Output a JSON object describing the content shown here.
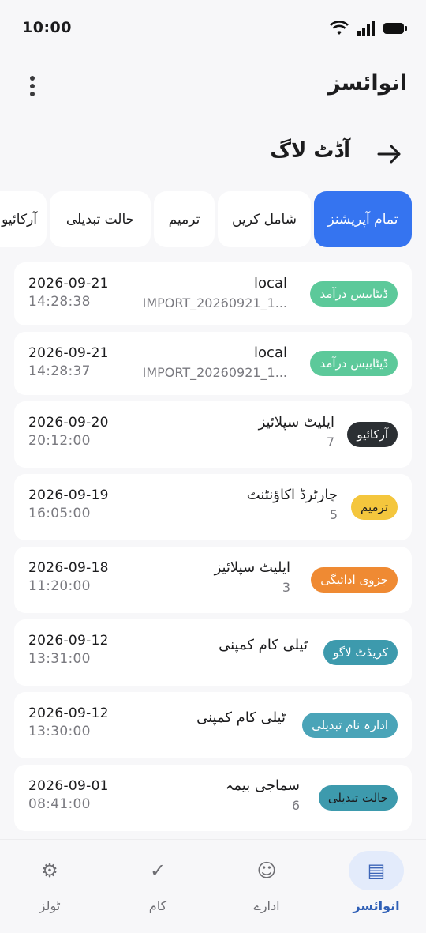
{
  "status_bar": {
    "time": "10:00"
  },
  "app_bar": {
    "title": "انوائسز"
  },
  "section": {
    "title": "آڈٹ لاگ"
  },
  "filters": [
    {
      "label": "تمام آپریشنز",
      "active": true
    },
    {
      "label": "شامل کریں",
      "active": false
    },
    {
      "label": "ترمیم",
      "active": false
    },
    {
      "label": "حالت تبدیلی",
      "active": false
    },
    {
      "label": "آرکائیو",
      "active": false
    }
  ],
  "entries": [
    {
      "badge": "ڈیٹابیس درآمد",
      "badge_color": "#5cc99a",
      "badge_text_color": "#ffffff",
      "title": "local",
      "subtitle": "IMPORT_20260921_1...",
      "date": "2026-09-21",
      "time": "14:28:38"
    },
    {
      "badge": "ڈیٹابیس درآمد",
      "badge_color": "#5cc99a",
      "badge_text_color": "#ffffff",
      "title": "local",
      "subtitle": "IMPORT_20260921_1...",
      "date": "2026-09-21",
      "time": "14:28:37"
    },
    {
      "badge": "آرکائیو",
      "badge_color": "#2b2f33",
      "badge_text_color": "#ffffff",
      "title": "ایلیٹ سپلائیز",
      "subtitle": "7",
      "date": "2026-09-20",
      "time": "20:12:00"
    },
    {
      "badge": "ترمیم",
      "badge_color": "#f4c63d",
      "badge_text_color": "#1c1c1e",
      "title": "چارٹرڈ اکاؤنٹنٹ",
      "subtitle": "5",
      "date": "2026-09-19",
      "time": "16:05:00"
    },
    {
      "badge": "جزوی ادائیگی",
      "badge_color": "#ef8a33",
      "badge_text_color": "#ffffff",
      "title": "ایلیٹ سپلائیز",
      "subtitle": "3",
      "date": "2026-09-18",
      "time": "11:20:00"
    },
    {
      "badge": "کریڈٹ لاگو",
      "badge_color": "#3d9aad",
      "badge_text_color": "#ffffff",
      "title": "ٹیلی کام کمپنی",
      "subtitle": "",
      "date": "2026-09-12",
      "time": "13:31:00"
    },
    {
      "badge": "ادارہ نام تبدیلی",
      "badge_color": "#4aa4b8",
      "badge_text_color": "#ffffff",
      "title": "ٹیلی کام کمپنی",
      "subtitle": "",
      "date": "2026-09-12",
      "time": "13:30:00"
    },
    {
      "badge": "حالت تبدیلی",
      "badge_color": "#3d9aad",
      "badge_text_color": "#1c1c1e",
      "title": "سماجی بیمہ",
      "subtitle": "6",
      "date": "2026-09-01",
      "time": "08:41:00"
    }
  ],
  "bottom_nav": [
    {
      "label": "انوائسز",
      "icon": "invoice-list-icon",
      "glyph": "▤",
      "active": true
    },
    {
      "label": "ادارے",
      "icon": "entities-icon",
      "glyph": "☺",
      "active": false
    },
    {
      "label": "کام",
      "icon": "check-icon",
      "glyph": "✓",
      "active": false
    },
    {
      "label": "ٹولز",
      "icon": "gear-icon",
      "glyph": "⚙",
      "active": false
    }
  ]
}
